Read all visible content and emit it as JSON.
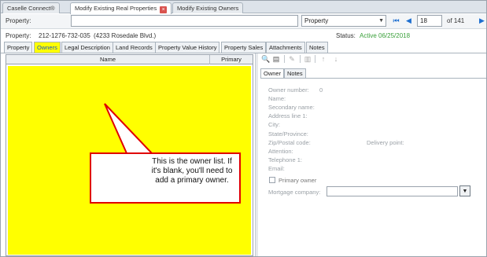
{
  "window_tabs": [
    {
      "label": "Caselle Connect®",
      "active": false
    },
    {
      "label": "Modify Existing Real Properties",
      "active": true
    },
    {
      "label": "Modify Existing Owners",
      "active": false
    }
  ],
  "property_bar": {
    "label": "Property:",
    "search_value": "",
    "type_select": "Property",
    "record_number": "18",
    "record_total": "of 141"
  },
  "property_info": {
    "label": "Property:",
    "id": "212-1276-732-035",
    "address": "(4233 Rosedale Blvd.)",
    "status_label": "Status:",
    "status_value": "Active 06/25/2018"
  },
  "section_tabs": [
    {
      "label": "Property",
      "active": false
    },
    {
      "label": "Owners",
      "active": true
    },
    {
      "label": "Legal Description",
      "active": false
    },
    {
      "label": "Land Records",
      "active": false
    },
    {
      "label": "Property Value History",
      "active": false
    },
    {
      "label": "Property Sales",
      "active": false
    },
    {
      "label": "Attachments",
      "active": false
    },
    {
      "label": "Notes",
      "active": false
    }
  ],
  "owner_list": {
    "columns": [
      "Name",
      "Primary"
    ],
    "rows": []
  },
  "callout": {
    "text": "This is the owner list. If it's blank, you'll need to add a primary owner."
  },
  "toolbar_icons": [
    "binoculars-icon",
    "new-document-icon",
    "edit-pencil-icon",
    "delete-icon",
    "move-up-icon",
    "move-down-icon"
  ],
  "detail_tabs": [
    {
      "label": "Owner",
      "active": true
    },
    {
      "label": "Notes",
      "active": false
    }
  ],
  "owner_detail": {
    "owner_number_label": "Owner number:",
    "owner_number_value": "0",
    "name_label": "Name:",
    "secondary_name_label": "Secondary name:",
    "address1_label": "Address line 1:",
    "city_label": "City:",
    "state_label": "State/Province:",
    "zip_label": "Zip/Postal code:",
    "delivery_point_label": "Delivery point:",
    "attention_label": "Attention:",
    "telephone_label": "Telephone 1:",
    "email_label": "Email:",
    "primary_owner_label": "Primary owner",
    "primary_owner_checked": false,
    "mortgage_label": "Mortgage company:",
    "mortgage_value": ""
  },
  "colors": {
    "highlight_yellow": "#ffff00",
    "callout_border": "#e00000",
    "status_green": "#3aa03a",
    "nav_blue": "#1e6fd0"
  }
}
